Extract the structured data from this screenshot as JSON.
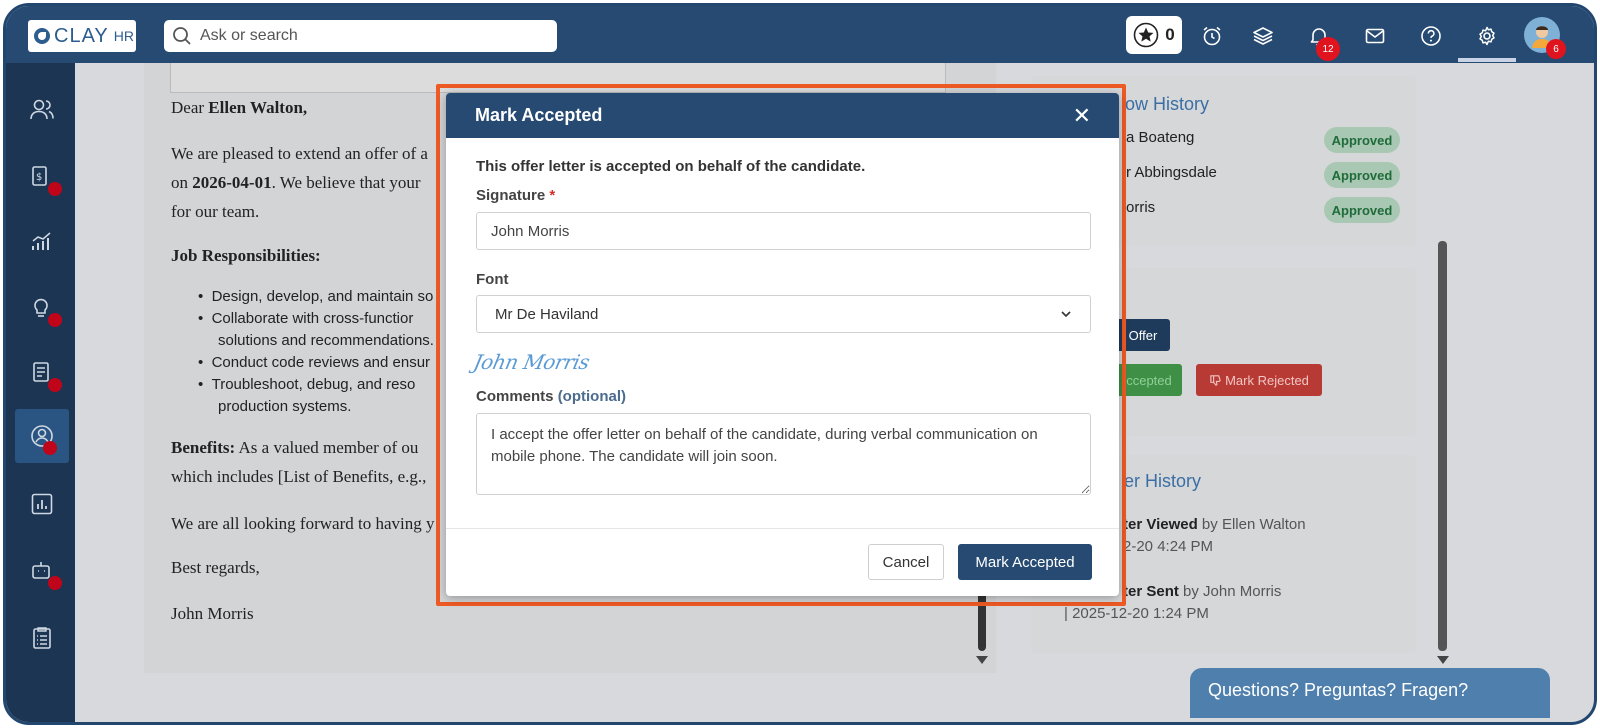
{
  "brand": {
    "name": "CLAY",
    "suffix": "HR"
  },
  "search": {
    "placeholder": "Ask or search"
  },
  "topbar": {
    "star_count": "0",
    "notifications_count": "12",
    "avatar_badge": "6"
  },
  "letter": {
    "greeting_prefix": "Dear ",
    "candidate": "Ellen Walton,",
    "para1_line1": "We are pleased to extend an offer of a",
    "para1_line2_prefix": "on ",
    "start_date": "2026-04-01",
    "para1_line2_suffix": ". We believe that your",
    "para1_line3": "for our team.",
    "responsibilities_heading": "Job Responsibilities:",
    "bullets": [
      "Design, develop, and maintain so",
      "Collaborate with cross-functior",
      "solutions and recommendations.",
      "Conduct code reviews and ensur",
      "Troubleshoot, debug, and reso",
      "production systems."
    ],
    "benefits_label": "Benefits:",
    "benefits_line1": " As a valued member of ou",
    "benefits_line2": "which includes [List of Benefits, e.g.,",
    "closing_line": "We are all looking forward to having y",
    "regards": "Best regards,",
    "signer": "John Morris"
  },
  "right_panel": {
    "workflow_title": "low History",
    "approvers": [
      {
        "name": "a Boateng",
        "status": "Approved"
      },
      {
        "name": "r Abbingsdale",
        "status": "Approved"
      },
      {
        "name": "orris",
        "status": "Approved"
      }
    ],
    "offer_button": "Offer",
    "accepted_button": "ccepted",
    "rejected_button": "Mark Rejected",
    "history_title": "er History",
    "events": [
      {
        "title": "ter Viewed",
        "by": " by Ellen Walton",
        "time": "2-20  4:24 PM"
      },
      {
        "title": "ter Sent",
        "by": " by John Morris",
        "time": "| 2025-12-20  1:24 PM"
      }
    ]
  },
  "help": {
    "label": "Questions? Preguntas? Fragen?"
  },
  "modal": {
    "title": "Mark Accepted",
    "intro": "This offer letter is accepted on behalf of the candidate.",
    "signature_label": "Signature",
    "required_mark": "*",
    "signature_value": "John Morris",
    "font_label": "Font",
    "font_value": "Mr De Haviland",
    "preview_text": "John Morris",
    "comments_label": "Comments",
    "comments_optional": "(optional)",
    "comments_value": "I accept the offer letter on behalf of the candidate, during verbal communication on mobile phone. The candidate will join soon.",
    "cancel_label": "Cancel",
    "submit_label": "Mark Accepted"
  },
  "colors": {
    "primary": "#264a71",
    "highlight": "#ee5a24",
    "approved": "#1f6b3a",
    "reject": "#c0392b",
    "accept": "#2e8b3e"
  }
}
